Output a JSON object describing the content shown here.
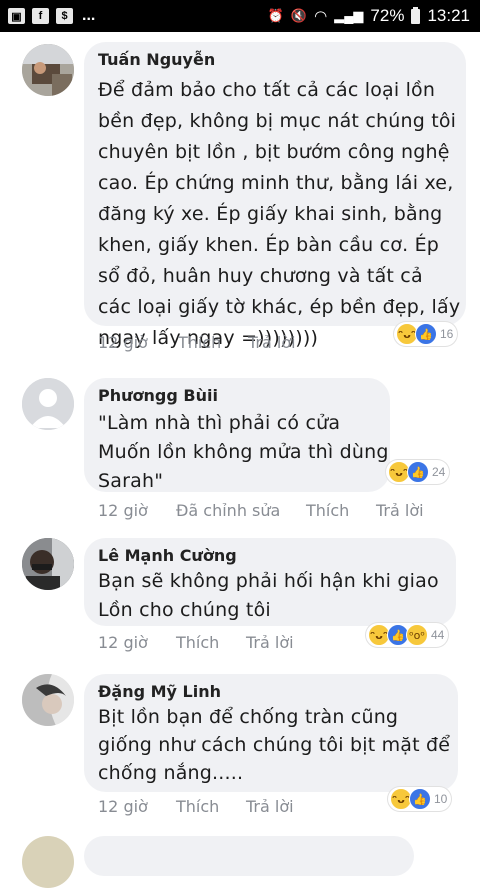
{
  "status_bar": {
    "icons_left": [
      "image-icon",
      "facebook-icon",
      "dollar-icon"
    ],
    "overflow": "...",
    "battery_percent": "72%",
    "time": "13:21"
  },
  "comments": [
    {
      "name": "Tuấn Nguyễn",
      "lines": [
        "Để đảm bảo cho tất cả các loại lồn",
        "bền đẹp, không bị mục nát chúng tôi",
        "chuyên bịt lồn , bịt bướm công nghệ",
        "cao. Ép chứng minh thư, bằng lái xe,",
        "đăng ký xe. Ép giấy khai sinh, bằng",
        "khen, giấy khen. Ép bàn cầu cơ. Ép",
        "sổ đỏ, huân huy chương và tất cả",
        "các loại giấy tờ khác, ép bền đẹp, lấy",
        "ngay lấy ngay =))))))))"
      ],
      "time": "12 giờ",
      "actions": [
        "Thích",
        "Trả lời"
      ],
      "reaction_count": "16"
    },
    {
      "name": "Phươngg Bùii",
      "lines": [
        "\"Làm nhà thì phải có cửa",
        "Muốn lồn không mửa thì dùng",
        "Sarah\""
      ],
      "time": "12 giờ",
      "actions": [
        "Đã chỉnh sửa",
        "Thích",
        "Trả lời"
      ],
      "reaction_count": "24"
    },
    {
      "name": "Lê Mạnh Cường",
      "lines": [
        "Bạn sẽ không phải hối hận khi giao",
        "Lồn cho chúng tôi"
      ],
      "time": "12 giờ",
      "actions": [
        "Thích",
        "Trả lời"
      ],
      "reaction_count": "44"
    },
    {
      "name": "Đặng Mỹ Linh",
      "lines": [
        "Bịt lồn bạn để chống tràn cũng",
        "giống như cách chúng tôi bịt mặt để",
        "chống nắng....."
      ],
      "time": "12 giờ",
      "actions": [
        "Thích",
        "Trả lời"
      ],
      "reaction_count": "10"
    }
  ]
}
